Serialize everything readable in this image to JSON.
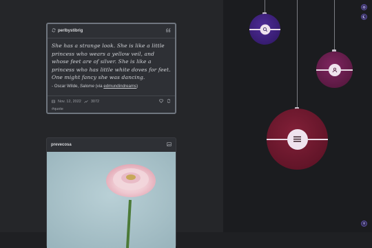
{
  "quote_post": {
    "username": "perlbystibrig",
    "quote": "She has a strange look. She is like a little princess who wears a yellow veil, and whose feet are of silver. She is like a princess who has little white doves for feet. One might fancy she was dancing.",
    "source_prefix": "- Oscar Wilde, ",
    "source_title": "Salome",
    "source_via_prefix": " (via ",
    "source_via_user": "edmundindreams",
    "source_via_suffix": ")",
    "date": "Nov. 12, 2022",
    "notes": "3072",
    "tag": "#quote"
  },
  "photo_post": {
    "username": "prevecosa"
  },
  "icons": {
    "reblog": "reblog-icon",
    "quote": "quote-icon",
    "calendar": "calendar-icon",
    "notes": "notes-icon",
    "like": "heart-icon",
    "share": "reblog-icon",
    "photo": "photo-icon",
    "search": "search-icon",
    "user": "user-icon",
    "menu": "menu-icon",
    "settings": "gear-icon",
    "theme": "moon-icon",
    "scroll_top": "arrow-up-icon"
  },
  "colors": {
    "orb_search": "#3e1f7f",
    "orb_user": "#6b1d4d",
    "orb_menu": "#6e1730",
    "background": "#1f2023"
  }
}
